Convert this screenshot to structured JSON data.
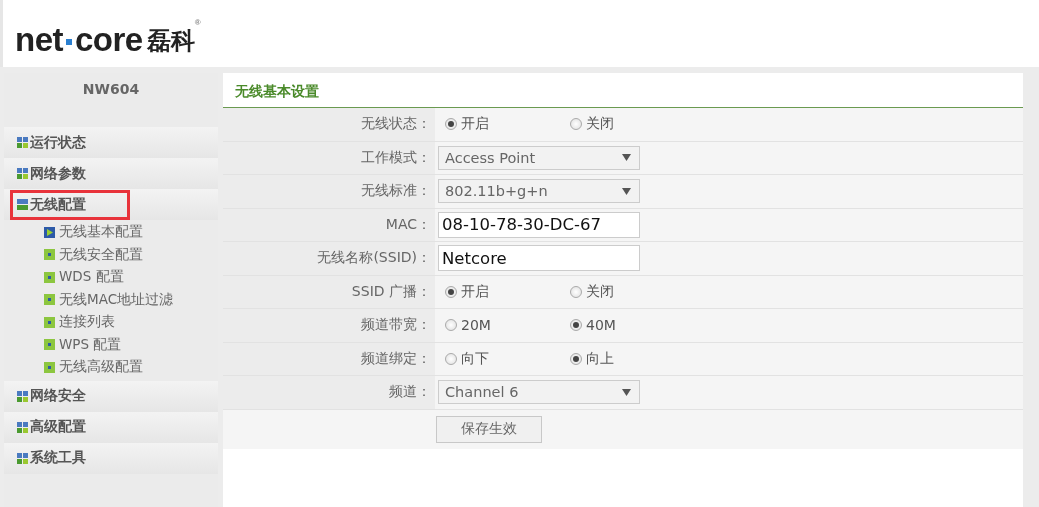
{
  "logo": {
    "part_1": "net",
    "part_2": "core",
    "chinese": "磊科",
    "mark": "®"
  },
  "sidebar": {
    "model": "NW604",
    "groups": [
      {
        "label": "运行状态",
        "expanded": false,
        "highlighted": false
      },
      {
        "label": "网络参数",
        "expanded": false,
        "highlighted": false
      },
      {
        "label": "无线配置",
        "expanded": true,
        "highlighted": true,
        "children": [
          {
            "label": "无线基本配置",
            "selected": true
          },
          {
            "label": "无线安全配置",
            "selected": false
          },
          {
            "label": "WDS 配置",
            "selected": false
          },
          {
            "label": "无线MAC地址过滤",
            "selected": false
          },
          {
            "label": "连接列表",
            "selected": false
          },
          {
            "label": "WPS 配置",
            "selected": false
          },
          {
            "label": "无线高级配置",
            "selected": false
          }
        ]
      },
      {
        "label": "网络安全",
        "expanded": false,
        "highlighted": false
      },
      {
        "label": "高级配置",
        "expanded": false,
        "highlighted": false
      },
      {
        "label": "系统工具",
        "expanded": false,
        "highlighted": false
      }
    ]
  },
  "panel": {
    "title": "无线基本设置",
    "rows": [
      {
        "kind": "radio",
        "label": "无线状态：",
        "options": [
          {
            "label": "开启",
            "selected": true
          },
          {
            "label": "关闭",
            "selected": false
          }
        ]
      },
      {
        "kind": "select",
        "label": "工作模式：",
        "value": "Access Point"
      },
      {
        "kind": "select",
        "label": "无线标准：",
        "value": "802.11b+g+n"
      },
      {
        "kind": "text",
        "label": "MAC：",
        "value": "08-10-78-30-DC-67"
      },
      {
        "kind": "text",
        "label": "无线名称(SSID)：",
        "value": "Netcore"
      },
      {
        "kind": "radio",
        "label": "SSID 广播：",
        "options": [
          {
            "label": "开启",
            "selected": true
          },
          {
            "label": "关闭",
            "selected": false
          }
        ]
      },
      {
        "kind": "radio",
        "label": "频道带宽：",
        "options": [
          {
            "label": "20M",
            "selected": false
          },
          {
            "label": "40M",
            "selected": true
          }
        ]
      },
      {
        "kind": "radio",
        "label": "频道绑定：",
        "options": [
          {
            "label": "向下",
            "selected": false
          },
          {
            "label": "向上",
            "selected": true
          }
        ]
      },
      {
        "kind": "select",
        "label": "频道：",
        "value": "Channel 6"
      },
      {
        "kind": "button",
        "value": "保存生效"
      }
    ]
  }
}
